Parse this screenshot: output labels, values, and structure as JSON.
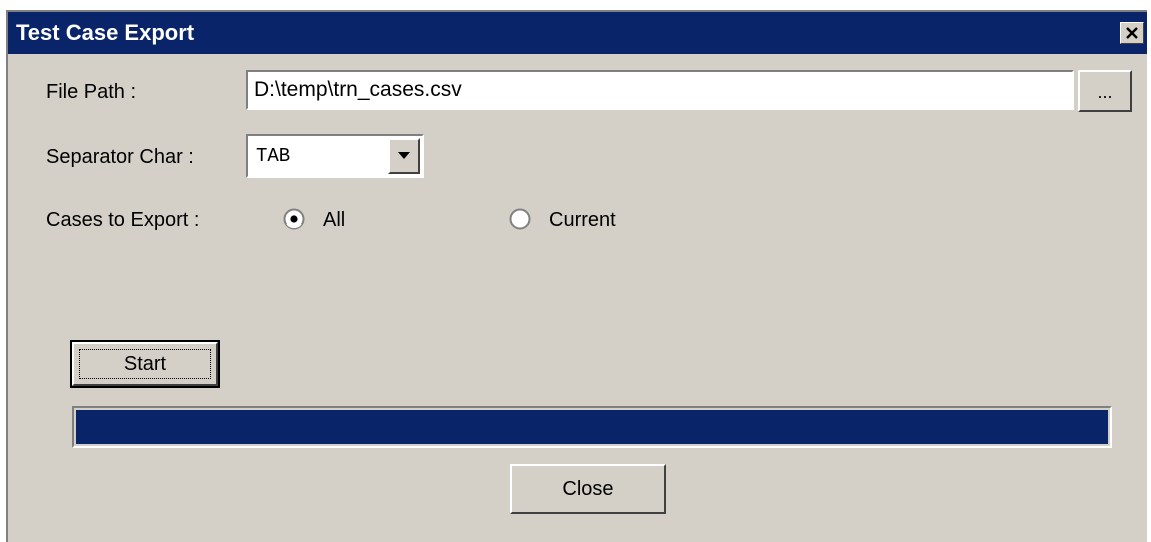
{
  "window": {
    "title": "Test Case Export",
    "close_glyph": "✕",
    "close_icon": "close-icon"
  },
  "file_path": {
    "label": "File Path :",
    "value": "D:\\temp\\trn_cases.csv",
    "browse_label": "..."
  },
  "separator": {
    "label": "Separator Char :",
    "selected": "TAB"
  },
  "cases": {
    "label": "Cases to Export :",
    "options": [
      {
        "label": "All",
        "selected": true
      },
      {
        "label": "Current",
        "selected": false
      }
    ]
  },
  "start_button": {
    "label": "Start"
  },
  "progress": {
    "percent": 100,
    "fill_color": "#0a246a"
  },
  "close_button": {
    "label": "Close"
  },
  "colors": {
    "title_bar": "#0a246a",
    "dialog_bg": "#d4d0c8"
  }
}
